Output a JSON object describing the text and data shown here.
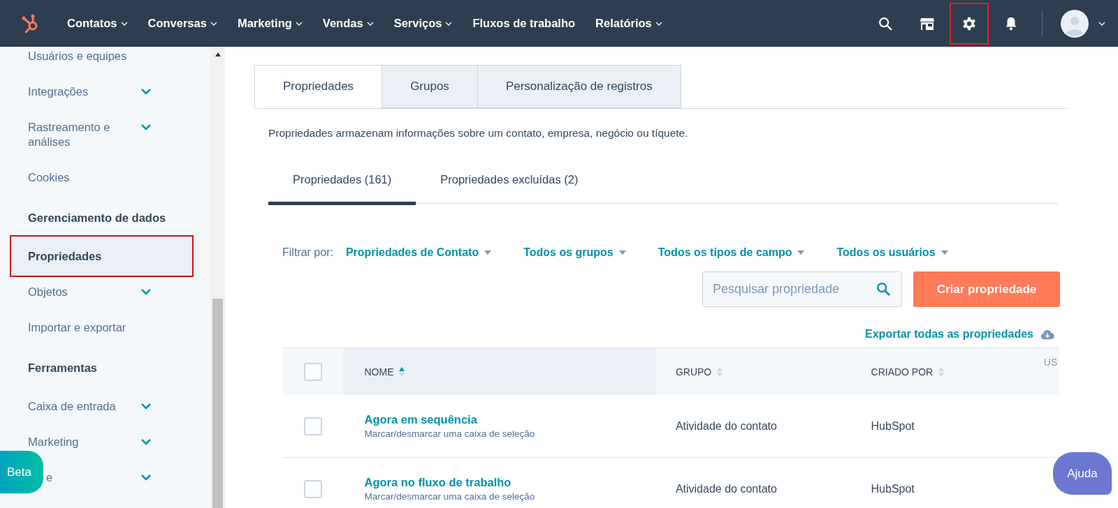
{
  "topbar": {
    "nav": [
      {
        "label": "Contatos",
        "has_menu": true
      },
      {
        "label": "Conversas",
        "has_menu": true
      },
      {
        "label": "Marketing",
        "has_menu": true
      },
      {
        "label": "Vendas",
        "has_menu": true
      },
      {
        "label": "Serviços",
        "has_menu": true
      },
      {
        "label": "Fluxos de trabalho",
        "has_menu": false
      },
      {
        "label": "Relatórios",
        "has_menu": true
      }
    ],
    "icons": [
      {
        "kind": "search",
        "highlighted": false
      },
      {
        "kind": "marketplace",
        "highlighted": false
      },
      {
        "kind": "settings",
        "highlighted": true
      },
      {
        "kind": "notifications",
        "highlighted": false
      }
    ]
  },
  "sidebar": {
    "items": [
      {
        "kind": "item",
        "label": "Usuários e equipes",
        "expandable": false,
        "selected": false,
        "highlighted": false
      },
      {
        "kind": "item",
        "label": "Integrações",
        "expandable": true,
        "selected": false,
        "highlighted": false
      },
      {
        "kind": "item",
        "label": "Rastreamento e análises",
        "expandable": true,
        "selected": false,
        "highlighted": false
      },
      {
        "kind": "item",
        "label": "Cookies",
        "expandable": false,
        "selected": false,
        "highlighted": false
      },
      {
        "kind": "header",
        "label": "Gerenciamento de dados"
      },
      {
        "kind": "item",
        "label": "Propriedades",
        "expandable": false,
        "selected": true,
        "highlighted": true
      },
      {
        "kind": "item",
        "label": "Objetos",
        "expandable": true,
        "selected": false,
        "highlighted": false
      },
      {
        "kind": "item",
        "label": "Importar e exportar",
        "expandable": false,
        "selected": false,
        "highlighted": false
      },
      {
        "kind": "header",
        "label": "Ferramentas"
      },
      {
        "kind": "item",
        "label": "Caixa de entrada",
        "expandable": true,
        "selected": false,
        "highlighted": false
      },
      {
        "kind": "item",
        "label": "Marketing",
        "expandable": true,
        "selected": false,
        "highlighted": false
      },
      {
        "kind": "partial",
        "label": "e",
        "expandable": true,
        "selected": false,
        "highlighted": false
      }
    ]
  },
  "tabs": [
    {
      "label": "Propriedades",
      "selected": true
    },
    {
      "label": "Grupos",
      "selected": false
    },
    {
      "label": "Personalização de registros",
      "selected": false
    }
  ],
  "description": "Propriedades armazenam informações sobre um contato, empresa, negócio ou tíquete.",
  "subtabs": [
    {
      "label": "Propriedades (161)",
      "selected": true
    },
    {
      "label": "Propriedades excluídas (2)",
      "selected": false
    }
  ],
  "filters": {
    "label": "Filtrar por:",
    "options": [
      "Propriedades de Contato",
      "Todos os grupos",
      "Todos os tipos de campo",
      "Todos os usuários"
    ]
  },
  "search": {
    "placeholder": "Pesquisar propriedade"
  },
  "create_button": "Criar propriedade",
  "export_link": "Exportar todas as propriedades",
  "table": {
    "all_checked": false,
    "columns": [
      {
        "label": "NOME",
        "sorted": true
      },
      {
        "label": "GRUPO",
        "sorted": false
      },
      {
        "label": "CRIADO POR",
        "sorted": false
      },
      {
        "label": "US"
      }
    ],
    "rows": [
      {
        "checked": false,
        "name": "Agora em sequência",
        "type": "Marcar/desmarcar uma caixa de seleção",
        "group": "Atividade do contato",
        "created_by": "HubSpot"
      },
      {
        "checked": false,
        "name": "Agora no fluxo de trabalho",
        "type": "Marcar/desmarcar uma caixa de seleção",
        "group": "Atividade do contato",
        "created_by": "HubSpot"
      }
    ]
  },
  "beta_button": "Beta",
  "help_button": "Ajuda"
}
